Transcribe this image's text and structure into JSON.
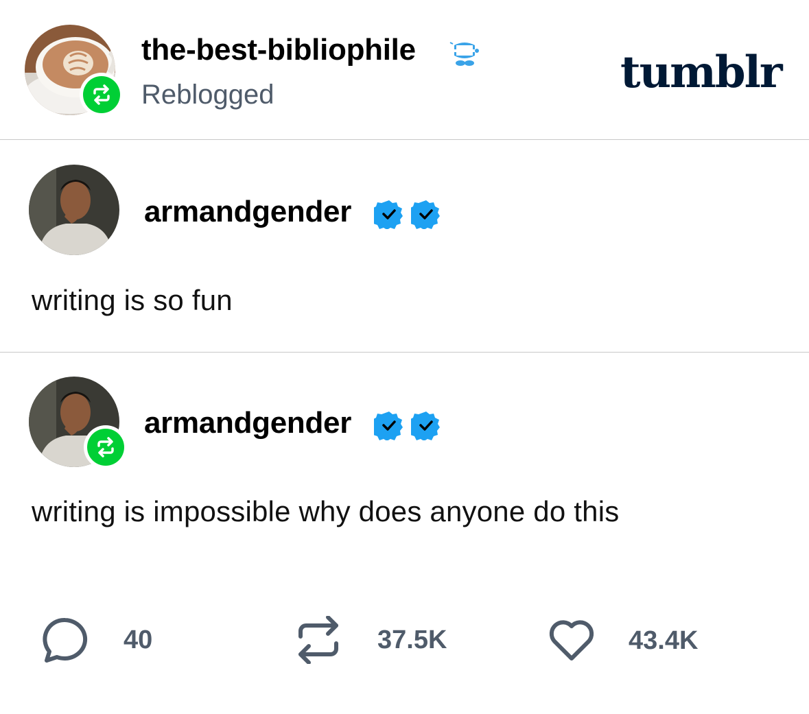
{
  "reblogger": {
    "username": "the-best-bibliophile",
    "status": "Reblogged",
    "avatar": "latte-art-coffee-cup",
    "badge_icon": "chattering-teeth-icon"
  },
  "brand": {
    "logo_text": "tumblr"
  },
  "posts": [
    {
      "username": "armandgender",
      "text": "writing is so fun",
      "avatar": "man-portrait",
      "verified_badges": 2
    },
    {
      "username": "armandgender",
      "text": "writing is impossible why does anyone do this",
      "avatar": "man-portrait",
      "verified_badges": 2,
      "reblogged": true
    }
  ],
  "actions": {
    "comments": "40",
    "reblogs": "37.5K",
    "likes": "43.4K"
  },
  "colors": {
    "reblog_green": "#00cf35",
    "verified_blue": "#1da1f2",
    "logo_navy": "#001935",
    "muted_text": "#4f5b6a"
  }
}
